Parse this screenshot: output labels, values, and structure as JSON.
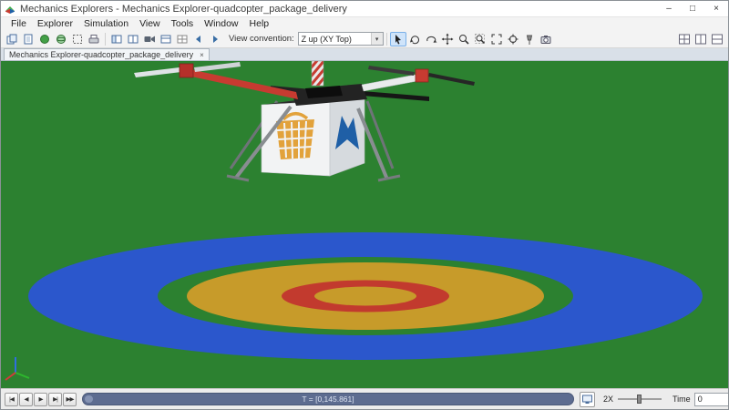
{
  "window": {
    "title": "Mechanics Explorers - Mechanics Explorer-quadcopter_package_delivery",
    "controls": {
      "minimize": "–",
      "maximize": "□",
      "close": "×"
    }
  },
  "menu": {
    "items": [
      "File",
      "Explorer",
      "Simulation",
      "View",
      "Tools",
      "Window",
      "Help"
    ]
  },
  "toolbar": {
    "view_convention_label": "View convention:",
    "view_convention_value": "Z up (XY Top)",
    "dropdown_arrow": "▾",
    "left_icons": [
      "copy-view",
      "new-view",
      "solid-sphere",
      "wire-sphere",
      "select-region",
      "print",
      "open-panel",
      "split-panel",
      "video-record",
      "panel-layout",
      "grid-view",
      "view-back",
      "view-forward"
    ],
    "nav_icons": [
      "select-cursor",
      "rotate-view",
      "roll-view",
      "pan-view",
      "zoom-view",
      "zoom-region",
      "fit-to-view",
      "look-at-point",
      "pin-view",
      "camera-views"
    ],
    "layout_icons": [
      "layout-grid",
      "layout-vertical",
      "layout-horizontal"
    ]
  },
  "tab": {
    "label": "Mechanics Explorer-quadcopter_package_delivery",
    "close_glyph": "×"
  },
  "viewport": {
    "background_color": "#2c8130",
    "landing_pad_colors": {
      "outer_ring": "#2b57cc",
      "gap_ring": "#2c8130",
      "gold_ring": "#c79b2a",
      "red_ring": "#c23a2e",
      "center": "#c79b2a"
    },
    "drone_colors": {
      "arm_red": "#c73b31",
      "arm_white": "#e9ebec",
      "body_dark": "#232323",
      "leg_gray": "#898d91",
      "package_front": "#f2f3f4",
      "package_side": "#d6dade",
      "basket_orange": "#e2a23b",
      "logo_blue": "#1f5fa6"
    }
  },
  "playback": {
    "buttons": [
      {
        "name": "go-to-start",
        "glyph": "|◀"
      },
      {
        "name": "step-back",
        "glyph": "◀"
      },
      {
        "name": "play",
        "glyph": "▶"
      },
      {
        "name": "step-forward",
        "glyph": "▶|"
      },
      {
        "name": "fast-forward",
        "glyph": "▶▶"
      }
    ],
    "scrub_text": "T = [0,145.861]",
    "speed_value": "2X",
    "time_label": "Time",
    "time_value": "0"
  }
}
